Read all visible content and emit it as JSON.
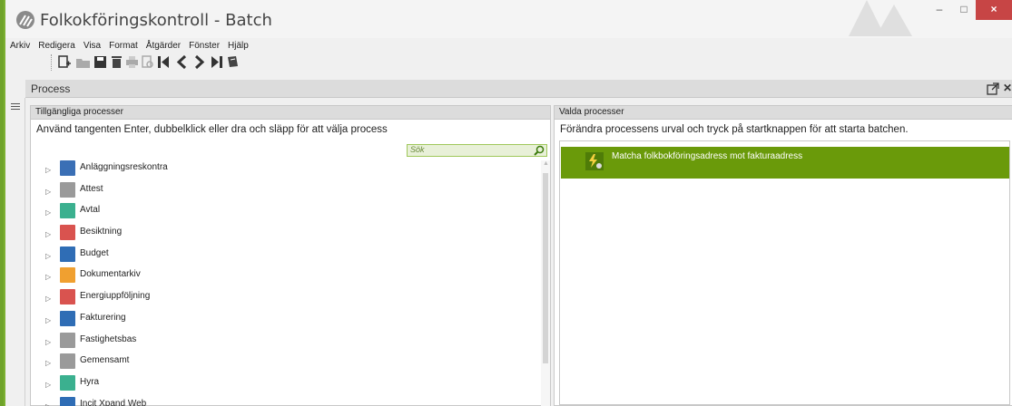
{
  "window": {
    "title": "Folkokföringskontroll - Batch"
  },
  "window_controls": {
    "minimize": "–",
    "maximize": "□",
    "close": "×"
  },
  "menu": [
    "Arkiv",
    "Redigera",
    "Visa",
    "Format",
    "Åtgärder",
    "Fönster",
    "Hjälp"
  ],
  "toolbar": [
    "new-icon",
    "open-icon",
    "save-icon",
    "delete-icon",
    "print-icon",
    "preview-icon",
    "first-icon",
    "prev-icon",
    "next-icon",
    "last-icon",
    "book-icon"
  ],
  "panel": {
    "title": "Process"
  },
  "left_pane": {
    "header": "Tillgängliga processer",
    "hint": "Använd tangenten Enter, dubbelklick eller dra och släpp för att välja process",
    "search_placeholder": "Sök",
    "items": [
      {
        "label": "Anläggningsreskontra",
        "color": "#3a6fb5"
      },
      {
        "label": "Attest",
        "color": "#9a9a9a"
      },
      {
        "label": "Avtal",
        "color": "#3bb08f"
      },
      {
        "label": "Besiktning",
        "color": "#d9534f"
      },
      {
        "label": "Budget",
        "color": "#2f6db5"
      },
      {
        "label": "Dokumentarkiv",
        "color": "#f0a030"
      },
      {
        "label": "Energiuppföljning",
        "color": "#d9534f"
      },
      {
        "label": "Fakturering",
        "color": "#2f6db5"
      },
      {
        "label": "Fastighetsbas",
        "color": "#9a9a9a"
      },
      {
        "label": "Gemensamt",
        "color": "#9a9a9a"
      },
      {
        "label": "Hyra",
        "color": "#3bb08f"
      },
      {
        "label": "Incit Xpand Web",
        "color": "#2f6db5"
      }
    ]
  },
  "right_pane": {
    "header": "Valda processer",
    "hint": "Förändra processens urval och tryck på startknappen för att starta batchen.",
    "selected": [
      {
        "label": "Matcha folkbokföringsadress mot fakturaadress"
      }
    ]
  },
  "colors": {
    "accent": "#6a9a0a",
    "frame": "#6fa32a",
    "close": "#c74545"
  }
}
